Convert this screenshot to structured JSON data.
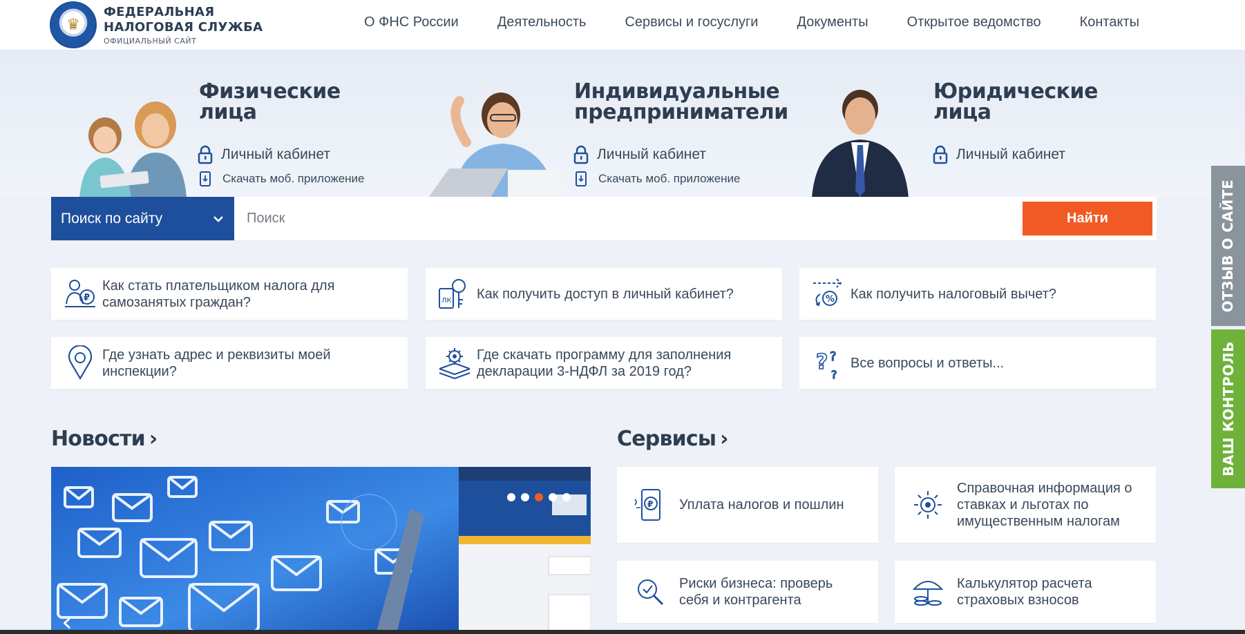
{
  "header": {
    "logo_line1": "ФЕДЕРАЛЬНАЯ",
    "logo_line2": "НАЛОГОВАЯ СЛУЖБА",
    "logo_line3": "ОФИЦИАЛЬНЫЙ САЙТ",
    "nav": [
      {
        "label": "О ФНС России"
      },
      {
        "label": "Деятельность"
      },
      {
        "label": "Сервисы и госуслуги"
      },
      {
        "label": "Документы"
      },
      {
        "label": "Открытое ведомство"
      },
      {
        "label": "Контакты"
      }
    ]
  },
  "hero": {
    "personas": [
      {
        "title_line1": "Физические",
        "title_line2": "лица",
        "cabinet": "Личный кабинет",
        "app": "Скачать моб. приложение"
      },
      {
        "title_line1": "Индивидуальные",
        "title_line2": "предприниматели",
        "cabinet": "Личный кабинет",
        "app": "Скачать моб. приложение"
      },
      {
        "title_line1": "Юридические",
        "title_line2": "лица",
        "cabinet": "Личный кабинет"
      }
    ]
  },
  "search": {
    "scope_label": "Поиск по сайту",
    "placeholder": "Поиск",
    "button_label": "Найти"
  },
  "faq": [
    {
      "text_l1": "Как стать плательщиком налога для",
      "text_l2": "самозанятых граждан?",
      "icon": "self-employed-icon"
    },
    {
      "text_l1": "Как получить доступ в личный кабинет?",
      "text_l2": "",
      "icon": "key-icon"
    },
    {
      "text_l1": "Как получить налоговый вычет?",
      "text_l2": "",
      "icon": "tax-deduction-icon"
    },
    {
      "text_l1": "Где узнать адрес и реквизиты моей",
      "text_l2": "инспекции?",
      "icon": "map-pin-icon"
    },
    {
      "text_l1": "Где скачать программу для заполнения",
      "text_l2": "декларации 3-НДФЛ за 2019 год?",
      "icon": "software-gear-icon"
    },
    {
      "text_l1": "Все вопросы и ответы...",
      "text_l2": "",
      "icon": "question-icon"
    }
  ],
  "sections": {
    "news_title": "Новости",
    "services_title": "Сервисы",
    "chevron": "›"
  },
  "services": [
    {
      "l1": "Уплата налогов и пошлин",
      "l2": "",
      "l3": "",
      "icon": "payment-phone-icon"
    },
    {
      "l1": "Справочная информация о",
      "l2": "ставках и льготах по",
      "l3": "имущественным налогам",
      "icon": "emblem-info-icon"
    },
    {
      "l1": "Риски бизнеса: проверь",
      "l2": "себя и контрагента",
      "l3": "",
      "icon": "risk-check-icon"
    },
    {
      "l1": "Калькулятор расчета",
      "l2": "страховых взносов",
      "l3": "",
      "icon": "insurance-calculator-icon"
    }
  ],
  "side_tabs": {
    "feedback": "ОТЗЫВ О САЙТЕ",
    "control": "ВАШ КОНТРОЛЬ"
  },
  "colors": {
    "brand_blue": "#1e4f9c",
    "accent_orange": "#f15a24",
    "feedback_tab": "#8a949c",
    "control_tab": "#6fb23a"
  }
}
